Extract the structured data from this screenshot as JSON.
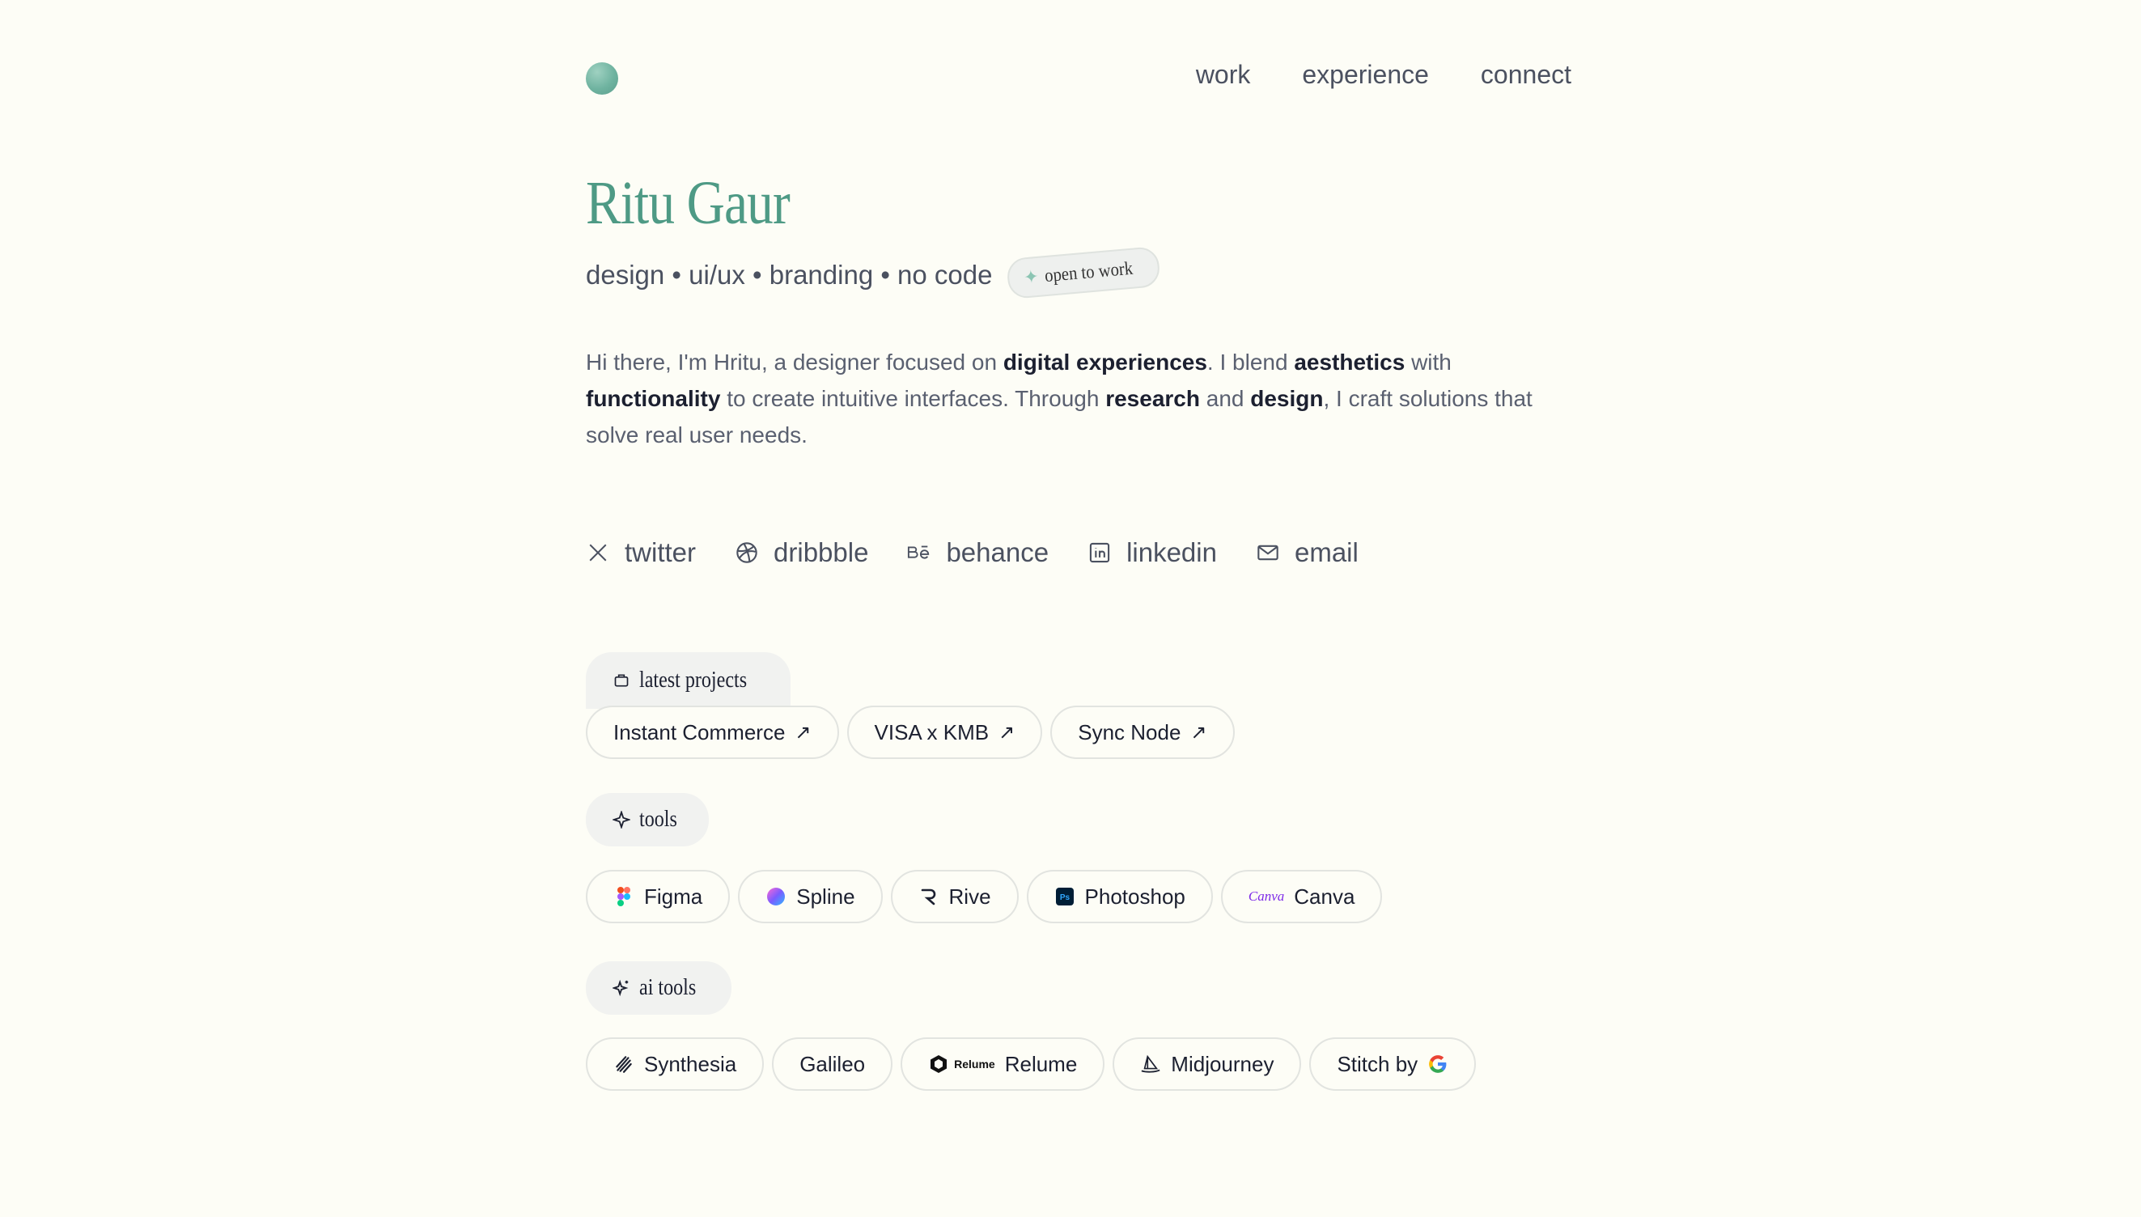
{
  "nav": {
    "work": "work",
    "experience": "experience",
    "connect": "connect"
  },
  "hero": {
    "name": "Ritu Gaur",
    "tagline": "design • ui/ux • branding • no code",
    "badge": "open to work"
  },
  "bio": {
    "p1": "Hi there, I'm Hritu, a designer focused on ",
    "b1": "digital experiences",
    "p2": ". I blend ",
    "b2": "aesthetics",
    "p3": " with ",
    "b3": "functionality",
    "p4": " to create intuitive interfaces. Through ",
    "b4": "research",
    "p5": " and ",
    "b5": "design",
    "p6": ", I craft solutions that solve real user needs."
  },
  "socials": [
    {
      "label": "twitter",
      "icon": "x-icon"
    },
    {
      "label": "dribbble",
      "icon": "dribbble-icon"
    },
    {
      "label": "behance",
      "icon": "behance-icon"
    },
    {
      "label": "linkedin",
      "icon": "linkedin-icon"
    },
    {
      "label": "email",
      "icon": "mail-icon"
    }
  ],
  "projects": {
    "title": "latest projects",
    "items": [
      "Instant Commerce",
      "VISA x KMB",
      "Sync Node"
    ]
  },
  "tools": {
    "title": "tools",
    "items": [
      "Figma",
      "Spline",
      "Rive",
      "Photoshop",
      "Canva"
    ],
    "canva_logo_text": "Canva"
  },
  "ai_tools": {
    "title": "ai tools",
    "items": [
      "Synthesia",
      "Galileo",
      "Relume",
      "Midjourney",
      "Stitch by"
    ],
    "relume_logo_text": "Relume"
  },
  "colors": {
    "accent": "#4e9a85",
    "background": "#fdfdf6",
    "text": "#4b5160"
  }
}
